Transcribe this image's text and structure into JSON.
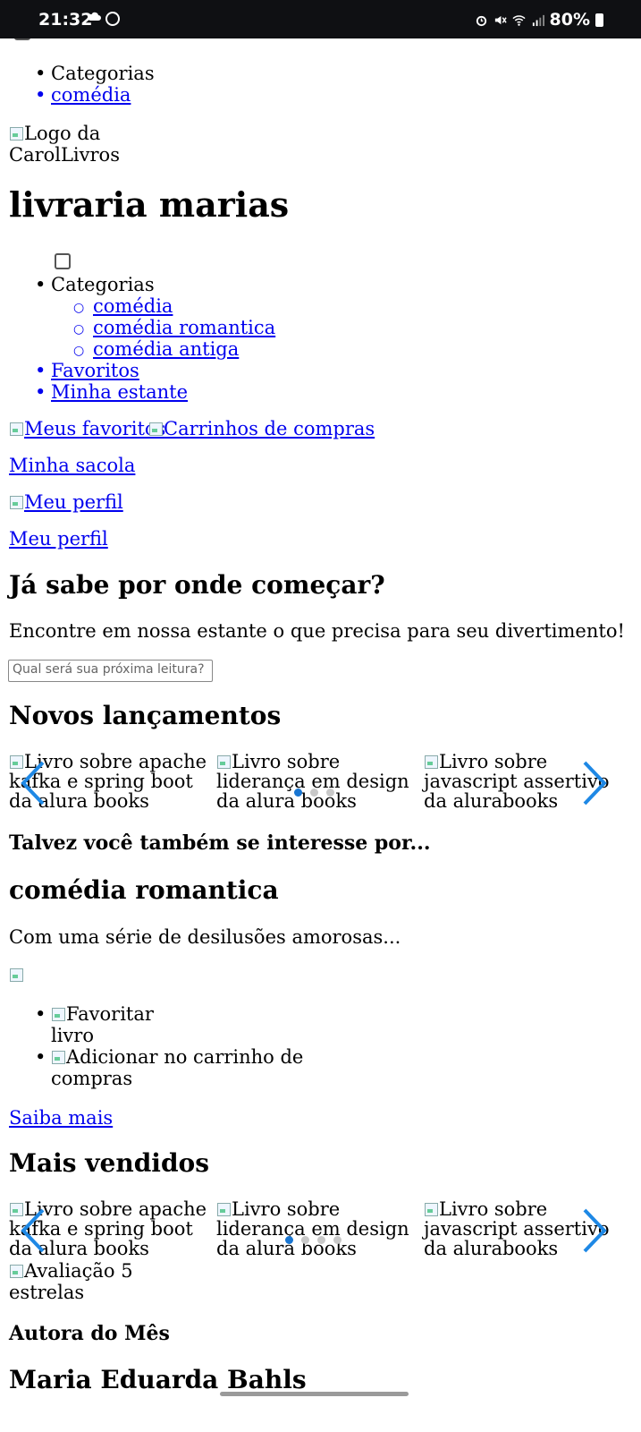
{
  "status_bar": {
    "time": "21:32",
    "battery": "80%"
  },
  "top_menu": {
    "categories_label": "Categorias",
    "items": [
      "comédia"
    ]
  },
  "logo_alt": "Logo da CarolLivros",
  "brand_title": "livraria marias",
  "nav": {
    "categories_label": "Categorias",
    "sub_items": [
      "comédia",
      "comédia romantica",
      "comédia antiga"
    ],
    "favorites": "Favoritos",
    "shelf": "Minha estante"
  },
  "actions": {
    "favorites_img": "Meus favoritos",
    "cart_img": "Carrinhos de compras",
    "bag_link": "Minha sacola",
    "profile_img": "Meu perfil",
    "profile_link": "Meu perfil"
  },
  "hero": {
    "heading": "Já sabe por onde começar?",
    "text": "Encontre em nossa estante o que precisa para seu divertimento!",
    "search_placeholder": "Qual será sua próxima leitura?"
  },
  "new_releases": {
    "heading": "Novos lançamentos",
    "slides": [
      "Livro sobre apache kafka e spring boot da alura books",
      "Livro sobre liderança em design da alura books",
      "Livro sobre javascript assertivo da alurabooks"
    ],
    "dots": 3,
    "active_dot": 0
  },
  "suggestion": {
    "heading": "Talvez você também se interesse por...",
    "title": "comédia romantica",
    "text": "Com uma série de desilusões amorosas...",
    "actions": [
      "Favoritar livro",
      "Adicionar no carrinho de compras"
    ],
    "more_link": "Saiba mais"
  },
  "best_sellers": {
    "heading": "Mais vendidos",
    "slides": [
      "Livro sobre apache kafka e spring boot da alura books",
      "Livro sobre liderança em design da alura books",
      "Livro sobre javascript assertivo da alurabooks"
    ],
    "dots": 4,
    "active_dot": 0,
    "rating_alt": "Avaliação 5 estrelas"
  },
  "author_month": {
    "heading": "Autora do Mês",
    "name": "Maria Eduarda Bahls"
  }
}
